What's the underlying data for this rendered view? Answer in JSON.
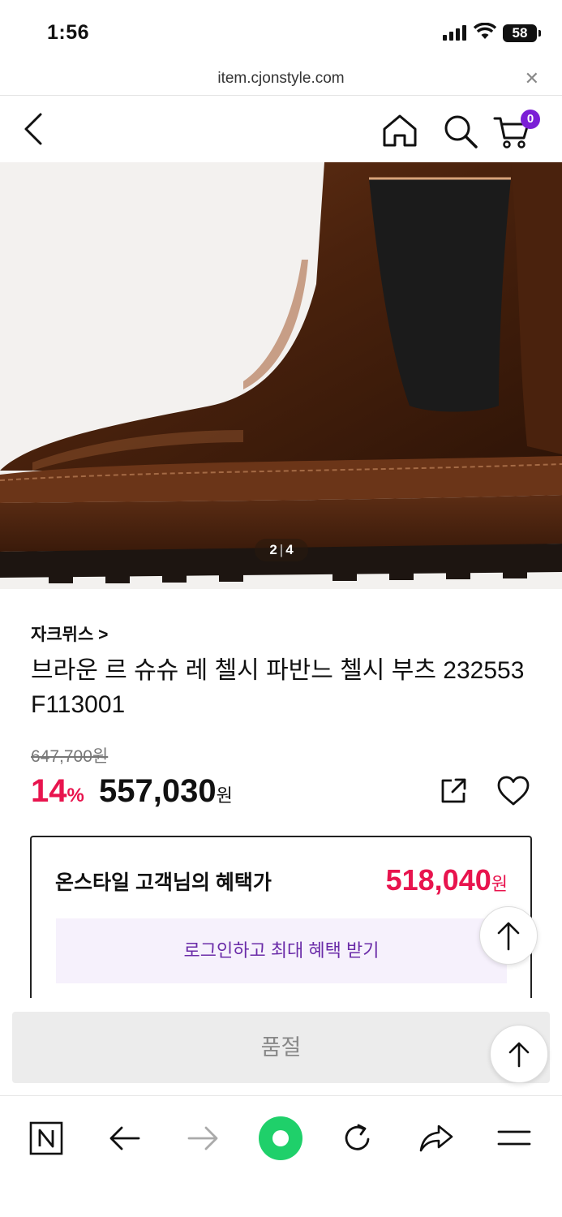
{
  "status_bar": {
    "time": "1:56",
    "battery": "58"
  },
  "url_bar": {
    "url": "item.cjonstyle.com"
  },
  "header": {
    "cart_count": "0"
  },
  "gallery": {
    "current": "2",
    "total": "4"
  },
  "product": {
    "brand": "자크뮈스 >",
    "title": "브라운 르 슈슈 레 첼시 파반느 첼시 부츠 232553 F113001",
    "original_price": "647,700원",
    "discount_rate": "14",
    "discount_unit": "%",
    "price": "557,030",
    "price_unit": "원"
  },
  "benefit": {
    "label": "온스타일 고객님의 혜택가",
    "price": "518,040",
    "price_unit": "원",
    "login_cta": "로그인하고 최대 혜택 받기"
  },
  "purchase": {
    "sold_out_label": "품절"
  },
  "colors": {
    "accent": "#e8144e",
    "brand_purple": "#7b1fd6",
    "naver_green": "#1fd06a"
  }
}
